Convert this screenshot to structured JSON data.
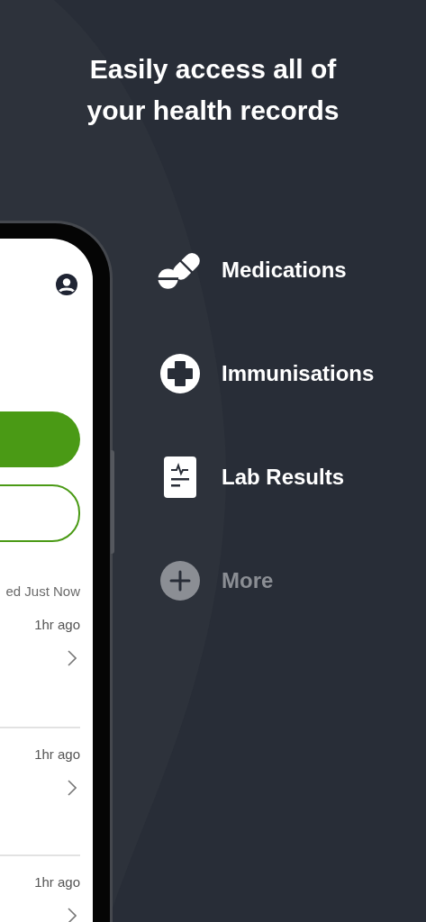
{
  "headline": "Easily access all of your health records",
  "features": [
    {
      "kind": "pills",
      "label": "Medications",
      "disabled": false
    },
    {
      "kind": "cross",
      "label": "Immunisations",
      "disabled": false
    },
    {
      "kind": "report",
      "label": "Lab Results",
      "disabled": false
    },
    {
      "kind": "add",
      "label": "More",
      "disabled": true
    }
  ],
  "phone": {
    "buttons": [
      {
        "kind": "filled"
      },
      {
        "kind": "outline"
      }
    ],
    "status": "ed Just Now",
    "records": [
      {
        "time": "1hr ago"
      },
      {
        "time": "1hr ago"
      },
      {
        "time": "1hr ago"
      }
    ]
  }
}
